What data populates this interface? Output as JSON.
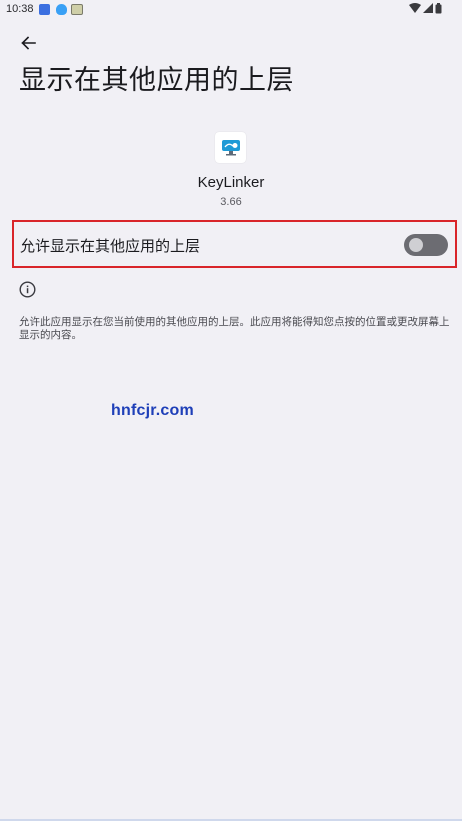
{
  "status_bar": {
    "time": "10:38"
  },
  "header": {
    "title": "显示在其他应用的上层"
  },
  "app": {
    "name": "KeyLinker",
    "version": "3.66"
  },
  "permission": {
    "label": "允许显示在其他应用的上层",
    "enabled": false
  },
  "description": "允许此应用显示在您当前使用的其他应用的上层。此应用将能得知您点按的位置或更改屏幕上显示的内容。",
  "watermark": "hnfcjr.com",
  "colors": {
    "background": "#f1f0f5",
    "highlight_border": "#d9252a",
    "toggle_track_off": "#6c6c72",
    "watermark": "#1e3fb8"
  },
  "icons": {
    "back": "arrow-left-icon",
    "info": "info-icon",
    "wifi": "wifi-icon",
    "signal": "signal-icon",
    "battery": "battery-icon"
  }
}
